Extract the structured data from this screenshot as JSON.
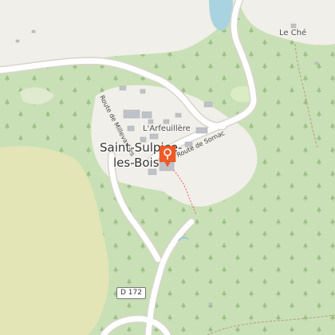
{
  "map": {
    "places": {
      "village_line1": "Saint-Sulpice-",
      "village_line2": "les-Bois",
      "arfeuillere": "L'Arfeuillère",
      "le_che": "Le Ché"
    },
    "roads": {
      "millevaches": "Route de Millevaches",
      "sornac": "Route de Sornac",
      "d172": "D 172"
    },
    "marker": {
      "icon": "map-pin-icon",
      "color": "#f05a28"
    },
    "colors": {
      "forest": "#c9e0b6",
      "clearing": "#f1efe9",
      "farmland": "#e3e5b6",
      "water": "#a9d3df",
      "road": "#ffffff",
      "building": "#bfc2c8",
      "tree_symbol": "#9cc086"
    }
  }
}
